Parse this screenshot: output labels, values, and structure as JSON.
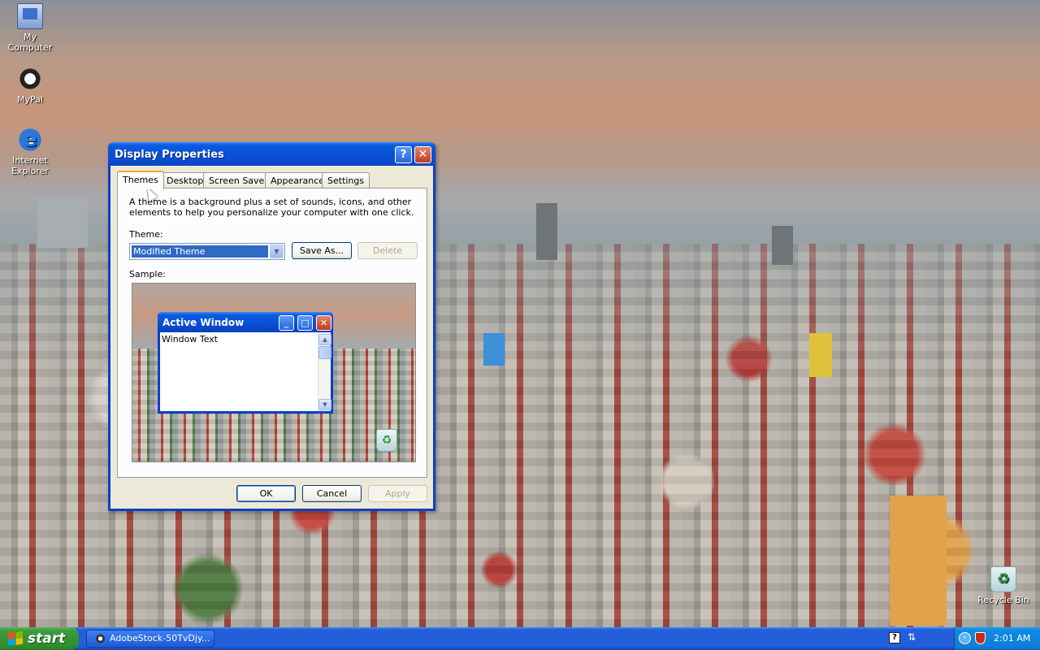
{
  "desktop": {
    "icons": [
      {
        "label": "My Computer",
        "icon": "my-computer-icon"
      },
      {
        "label": "MyPal",
        "icon": "mypal-browser-icon"
      },
      {
        "label": "Internet Explorer",
        "icon": "internet-explorer-icon"
      },
      {
        "label": "Recycle Bin",
        "icon": "recycle-bin-icon"
      }
    ]
  },
  "dialog": {
    "title": "Display Properties",
    "help_glyph": "?",
    "close_glyph": "✕",
    "tabs": [
      "Themes",
      "Desktop",
      "Screen Saver",
      "Appearance",
      "Settings"
    ],
    "active_tab": "Themes",
    "description": "A theme is a background plus a set of sounds, icons, and other elements to help you personalize your computer with one click.",
    "theme_label": "Theme:",
    "theme_value": "Modified Theme",
    "save_as_label": "Save As...",
    "delete_label": "Delete",
    "sample_label": "Sample:",
    "sample_window": {
      "title": "Active Window",
      "text": "Window Text",
      "minimize_glyph": "_",
      "maximize_glyph": "□",
      "close_glyph": "✕"
    },
    "ok_label": "OK",
    "cancel_label": "Cancel",
    "apply_label": "Apply"
  },
  "taskbar": {
    "start_label": "start",
    "task_item": "AdobeStock-50TvDjy...",
    "clock": "2:01 AM",
    "tray_help_glyph": "?",
    "tray_chevron_glyph": "‹"
  },
  "colors": {
    "title_blue": "#0a5ce0",
    "start_green": "#3c9b3c",
    "tray_blue": "#0f8ae3",
    "selection_blue": "#316ac5"
  }
}
